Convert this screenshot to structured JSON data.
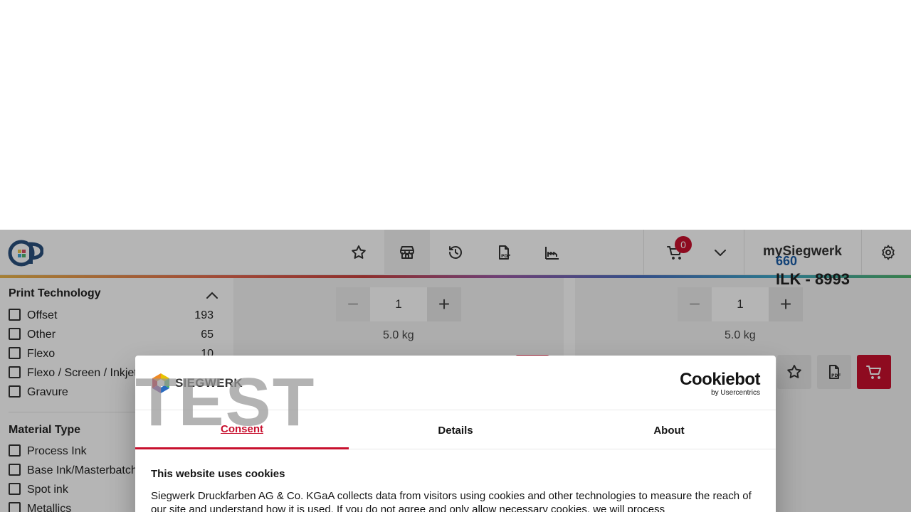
{
  "header": {
    "cart_count": "0",
    "brand_text": "mySiegwerk",
    "icons": [
      "star-icon",
      "store-icon",
      "history-icon",
      "pdf-icon",
      "factory-icon",
      "cart-icon",
      "chevron-down-icon",
      "gear-icon"
    ]
  },
  "sidebar": {
    "print_technology": {
      "title": "Print Technology",
      "items": [
        {
          "label": "Offset",
          "count": "193"
        },
        {
          "label": "Other",
          "count": "65"
        },
        {
          "label": "Flexo",
          "count": "10"
        },
        {
          "label": "Flexo / Screen / Inkjet",
          "count": ""
        },
        {
          "label": "Gravure",
          "count": ""
        }
      ]
    },
    "material_type": {
      "title": "Material Type",
      "items": [
        {
          "label": "Process Ink"
        },
        {
          "label": "Base Ink/Masterbatch"
        },
        {
          "label": "Spot ink"
        },
        {
          "label": "Metallics"
        }
      ]
    }
  },
  "products": {
    "col1": {
      "qty": "1",
      "weight": "5.0 kg"
    },
    "col2": {
      "qty": "1",
      "weight": "5.0 kg",
      "link_text": "660",
      "name_text": "ILK - 8993"
    }
  },
  "dialog": {
    "brand": "SIEGWERK",
    "watermark": "TEST",
    "cookiebot_main": "Cookiebot",
    "cookiebot_sub": "by Usercentrics",
    "tabs": [
      "Consent",
      "Details",
      "About"
    ],
    "title": "This website uses cookies",
    "body": "Siegwerk Druckfarben AG & Co. KGaA collects data from visitors using cookies and other technologies to measure the reach of our site and understand how it is used. If you do not agree and only allow necessary cookies, we will process"
  },
  "colors": {
    "accent": "#c8102e",
    "link": "#1b5ea8"
  }
}
